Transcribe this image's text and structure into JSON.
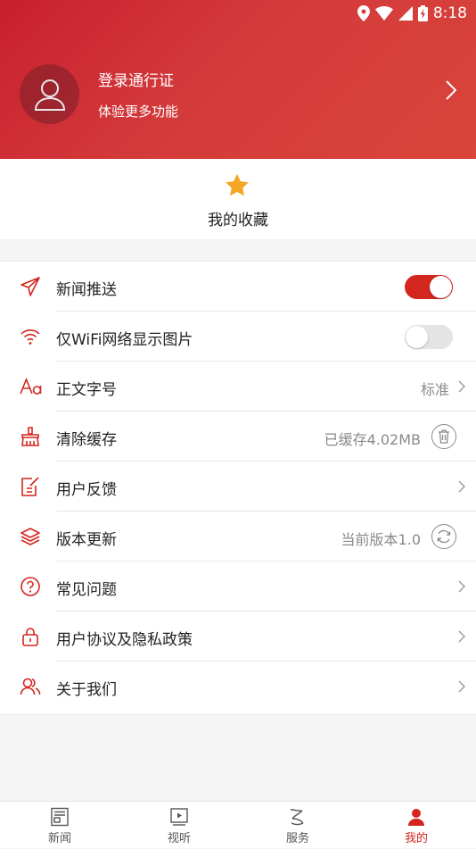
{
  "status_bar": {
    "time": "8:18"
  },
  "header": {
    "login_title": "登录通行证",
    "login_subtitle": "体验更多功能"
  },
  "favorites": {
    "label": "我的收藏"
  },
  "settings": [
    {
      "label": "新闻推送",
      "icon": "send-icon",
      "control": "toggle",
      "toggle_on": true
    },
    {
      "label": "仅WiFi网络显示图片",
      "icon": "wifi-icon",
      "control": "toggle",
      "toggle_on": false
    },
    {
      "label": "正文字号",
      "icon": "font-size-icon",
      "value": "标准",
      "control": "chevron"
    },
    {
      "label": "清除缓存",
      "icon": "broom-icon",
      "value": "已缓存4.02MB",
      "control": "trash-button"
    },
    {
      "label": "用户反馈",
      "icon": "feedback-icon",
      "control": "chevron"
    },
    {
      "label": "版本更新",
      "icon": "layers-icon",
      "value": "当前版本1.0",
      "control": "refresh-button"
    },
    {
      "label": "常见问题",
      "icon": "question-icon",
      "control": "chevron"
    },
    {
      "label": "用户协议及隐私政策",
      "icon": "lock-icon",
      "control": "chevron"
    },
    {
      "label": "关于我们",
      "icon": "users-icon",
      "control": "chevron"
    }
  ],
  "tabs": [
    {
      "label": "新闻",
      "icon": "news-icon",
      "active": false
    },
    {
      "label": "视听",
      "icon": "video-icon",
      "active": false
    },
    {
      "label": "服务",
      "icon": "service-icon",
      "active": false
    },
    {
      "label": "我的",
      "icon": "profile-icon",
      "active": true
    }
  ],
  "colors": {
    "accent": "#d3261e",
    "header_gradient_start": "#c8202e",
    "header_gradient_end": "#d9453a",
    "star": "#f5a623"
  }
}
